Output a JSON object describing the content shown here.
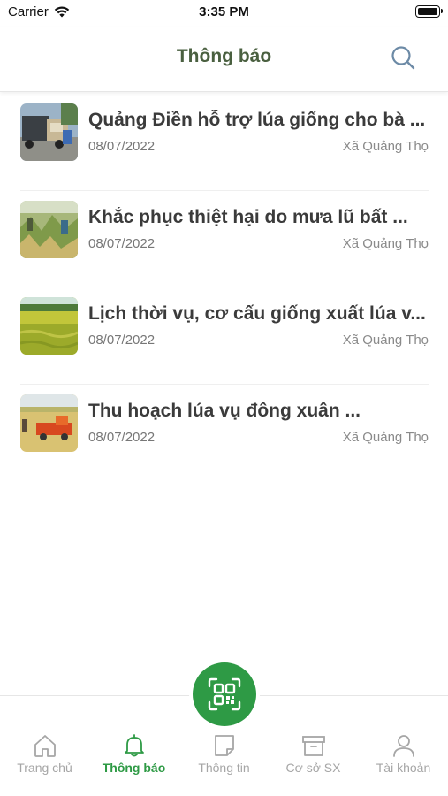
{
  "status_bar": {
    "carrier": "Carrier",
    "time": "3:35 PM"
  },
  "header": {
    "title": "Thông báo",
    "search_icon": "search-icon"
  },
  "news": [
    {
      "title": "Quảng Điền hỗ trợ lúa giống cho bà ...",
      "date": "08/07/2022",
      "source": "Xã Quảng Thọ"
    },
    {
      "title": "Khắc phục thiệt hại do mưa lũ bất ...",
      "date": "08/07/2022",
      "source": "Xã Quảng Thọ"
    },
    {
      "title": "Lịch thời vụ, cơ cấu giống xuất lúa v...",
      "date": "08/07/2022",
      "source": "Xã Quảng Thọ"
    },
    {
      "title": " Thu hoạch lúa vụ đông xuân ...",
      "date": "08/07/2022",
      "source": "Xã Quảng Thọ"
    }
  ],
  "tabbar": {
    "scan_icon": "qr-scan-icon",
    "tabs": [
      {
        "label": "Trang chủ",
        "icon": "home-icon",
        "active": false
      },
      {
        "label": "Thông báo",
        "icon": "bell-icon",
        "active": true
      },
      {
        "label": "Thông tin",
        "icon": "note-icon",
        "active": false
      },
      {
        "label": "Cơ sở SX",
        "icon": "archive-box-icon",
        "active": false
      },
      {
        "label": "Tài khoản",
        "icon": "user-icon",
        "active": false
      }
    ]
  },
  "colors": {
    "accent_green": "#2e9a45",
    "title_green": "#4a6040",
    "inactive_gray": "#a6a6a6"
  }
}
